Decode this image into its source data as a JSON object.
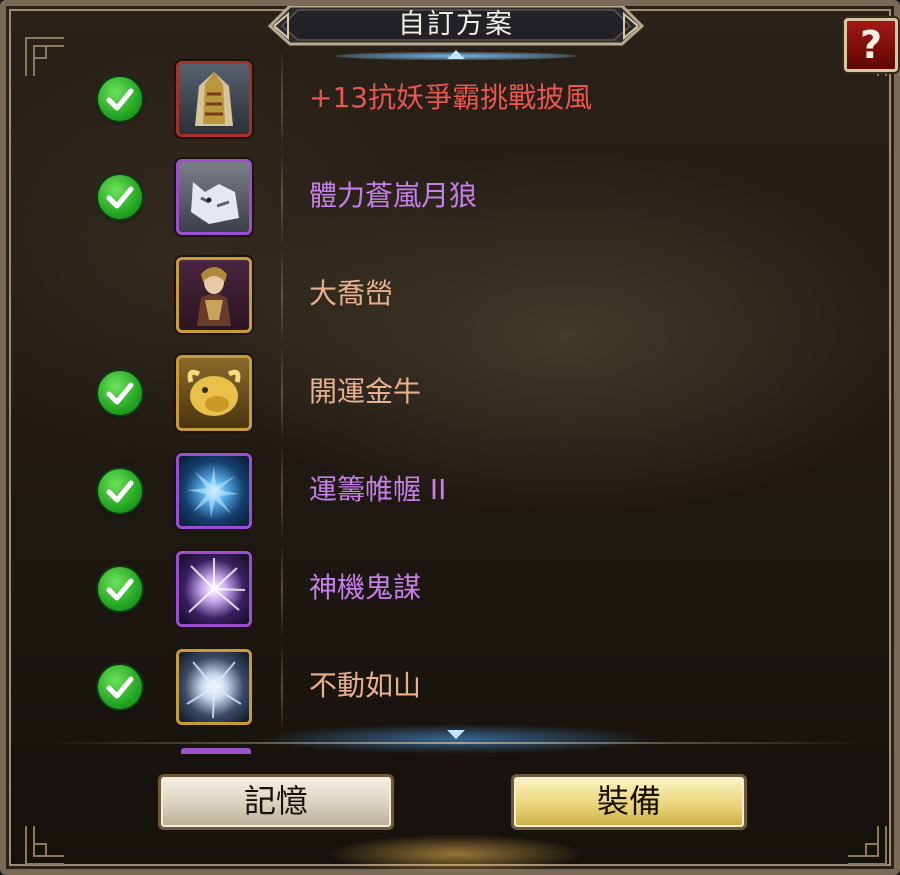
{
  "window": {
    "title": "自訂方案",
    "help_label": "?"
  },
  "items": [
    {
      "name": "+13抗妖爭霸挑戰披風",
      "checked": true,
      "name_color": "#e8564f",
      "border_color": "#a8302a",
      "icon": "cloak-icon"
    },
    {
      "name": "體力蒼嵐月狼",
      "checked": true,
      "name_color": "#c47fe8",
      "border_color": "#9a4fd0",
      "icon": "wolf-icon"
    },
    {
      "name": "大喬嵤",
      "checked": false,
      "name_color": "#e7b08e",
      "border_color": "#c99a3a",
      "icon": "general-portrait-icon"
    },
    {
      "name": "開運金牛",
      "checked": true,
      "name_color": "#e7b08e",
      "border_color": "#c99a3a",
      "icon": "golden-ox-icon"
    },
    {
      "name": "運籌帷幄 II",
      "checked": true,
      "name_color": "#c47fe8",
      "border_color": "#9a4fd0",
      "icon": "blue-orb-skill-icon"
    },
    {
      "name": "神機鬼謀",
      "checked": true,
      "name_color": "#c47fe8",
      "border_color": "#9a4fd0",
      "icon": "lightning-orb-skill-icon"
    },
    {
      "name": "不動如山",
      "checked": true,
      "name_color": "#e7b08e",
      "border_color": "#c99a3a",
      "icon": "silver-orb-skill-icon"
    }
  ],
  "buttons": {
    "memory_label": "記憶",
    "equip_label": "裝備"
  },
  "colors": {
    "accent_gold": "#c99a3a",
    "rare_purple": "#c47fe8",
    "legend_red": "#e8564f",
    "check_green": "#25a624"
  }
}
